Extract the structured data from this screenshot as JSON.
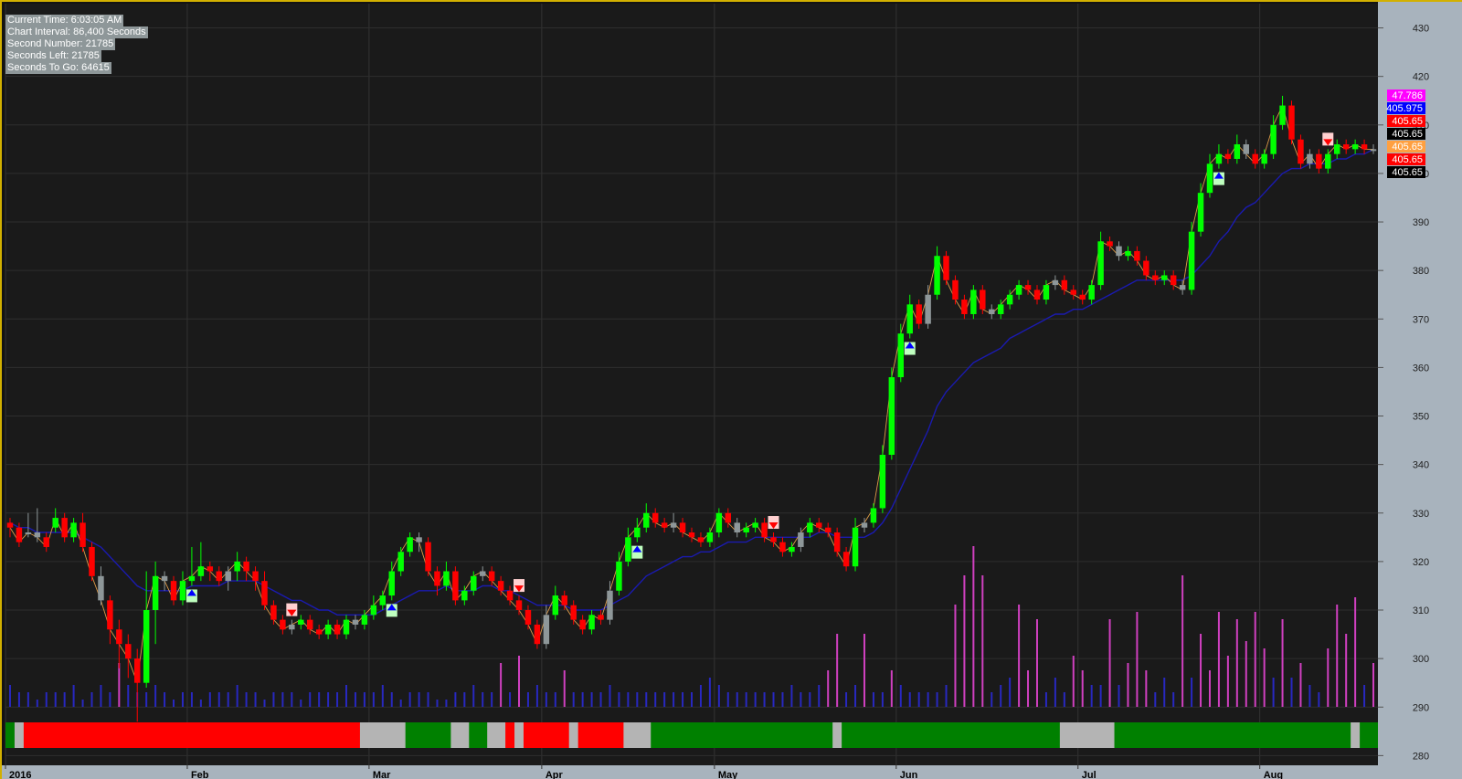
{
  "info": [
    "Current Time: 6:03:05 AM",
    "Chart Interval: 86,400 Seconds",
    "Second Number: 21785",
    "Seconds Left: 21785",
    "Seconds To Go: 64615"
  ],
  "colors": {
    "up": "#00ff00",
    "down": "#ff0000",
    "neutral": "#8e9799",
    "ma": "#1a1ab0",
    "zigzag": "#ffb050",
    "volume_up": "#d040c0",
    "volume_base": "#2828c0",
    "bar_green": "#008000",
    "bar_red": "#ff0000",
    "bar_gray": "#b4b4b4"
  },
  "price_labels": [
    {
      "text": "47.786",
      "bg": "#ff00ff",
      "fg": "#ffffff"
    },
    {
      "text": "405.975",
      "bg": "#0000ff",
      "fg": "#ffffff"
    },
    {
      "text": "405.65",
      "bg": "#ff0000",
      "fg": "#ffffff"
    },
    {
      "text": "405.65",
      "bg": "#000000",
      "fg": "#ffffff"
    },
    {
      "text": "405.65",
      "bg": "#ffa040",
      "fg": "#ffffff"
    },
    {
      "text": "405.65",
      "bg": "#ff0000",
      "fg": "#ffffff"
    },
    {
      "text": "405.65",
      "bg": "#000000",
      "fg": "#ffffff"
    }
  ],
  "chart_data": {
    "type": "candlestick",
    "y_ticks": [
      280,
      290,
      300,
      310,
      320,
      330,
      340,
      350,
      360,
      370,
      380,
      390,
      400,
      410,
      420,
      430
    ],
    "ylim": [
      278,
      435
    ],
    "x_labels": [
      "2016",
      "Feb",
      "Mar",
      "Apr",
      "May",
      "Jun",
      "Jul",
      "Aug"
    ],
    "x_label_index": [
      0,
      20,
      40,
      59,
      78,
      98,
      118,
      138
    ],
    "grid": true,
    "series_close": [
      327,
      324,
      326,
      325,
      323,
      329,
      325,
      328,
      323,
      317,
      312,
      306,
      303,
      300,
      295,
      310,
      317,
      316,
      312,
      316,
      317,
      319,
      318,
      316,
      318,
      320,
      318,
      316,
      311,
      308,
      306,
      307,
      308,
      306,
      305,
      307,
      305,
      308,
      307,
      309,
      311,
      313,
      318,
      322,
      325,
      324,
      318,
      315,
      318,
      312,
      314,
      317,
      318,
      316,
      314,
      312,
      310,
      307,
      303,
      309,
      313,
      311,
      308,
      306,
      309,
      308,
      314,
      320,
      325,
      327,
      330,
      328,
      327,
      328,
      326,
      325,
      324,
      326,
      330,
      328,
      326,
      327,
      328,
      325,
      324,
      322,
      323,
      326,
      328,
      327,
      326,
      322,
      319,
      327,
      328,
      331,
      342,
      358,
      367,
      373,
      369,
      375,
      383,
      378,
      374,
      371,
      376,
      372,
      371,
      373,
      375,
      377,
      376,
      374,
      377,
      378,
      376,
      375,
      374,
      377,
      386,
      385,
      383,
      384,
      382,
      379,
      378,
      379,
      377,
      376,
      388,
      396,
      402,
      404,
      403,
      406,
      404,
      402,
      404,
      410,
      414,
      407,
      402,
      404,
      401,
      404,
      406,
      405,
      406,
      405,
      405
    ],
    "candles": [
      [
        327,
        328,
        325,
        329
      ],
      [
        324,
        327,
        323,
        328
      ],
      [
        326,
        326,
        325,
        330
      ],
      [
        325,
        326,
        324,
        331
      ],
      [
        323,
        325,
        322,
        326
      ],
      [
        329,
        327,
        326,
        331
      ],
      [
        325,
        329,
        324,
        330
      ],
      [
        328,
        325,
        324,
        329
      ],
      [
        323,
        328,
        322,
        330
      ],
      [
        317,
        323,
        316,
        324
      ],
      [
        312,
        317,
        311,
        319
      ],
      [
        306,
        312,
        303,
        313
      ],
      [
        303,
        306,
        298,
        308
      ],
      [
        300,
        303,
        296,
        305
      ],
      [
        295,
        300,
        287,
        302
      ],
      [
        310,
        295,
        294,
        318
      ],
      [
        317,
        310,
        303,
        320
      ],
      [
        316,
        317,
        314,
        318
      ],
      [
        312,
        316,
        311,
        317
      ],
      [
        316,
        312,
        311,
        318
      ],
      [
        317,
        316,
        315,
        323
      ],
      [
        319,
        317,
        316,
        324
      ],
      [
        318,
        319,
        316,
        320
      ],
      [
        316,
        318,
        315,
        319
      ],
      [
        318,
        316,
        314,
        319
      ],
      [
        320,
        318,
        316,
        322
      ],
      [
        318,
        320,
        316,
        321
      ],
      [
        316,
        318,
        314,
        319
      ],
      [
        311,
        316,
        310,
        318
      ],
      [
        308,
        311,
        307,
        312
      ],
      [
        306,
        308,
        305,
        309
      ],
      [
        307,
        306,
        305,
        308
      ],
      [
        308,
        307,
        306,
        309
      ],
      [
        306,
        308,
        305,
        309
      ],
      [
        305,
        306,
        304,
        307
      ],
      [
        307,
        305,
        304,
        308
      ],
      [
        305,
        307,
        304,
        308
      ],
      [
        308,
        305,
        304,
        309
      ],
      [
        307,
        308,
        306,
        309
      ],
      [
        309,
        307,
        306,
        310
      ],
      [
        311,
        309,
        308,
        313
      ],
      [
        313,
        311,
        310,
        314
      ],
      [
        318,
        313,
        312,
        320
      ],
      [
        322,
        318,
        317,
        323
      ],
      [
        325,
        322,
        321,
        326
      ],
      [
        324,
        325,
        322,
        326
      ],
      [
        318,
        324,
        317,
        325
      ],
      [
        315,
        318,
        313,
        319
      ],
      [
        318,
        315,
        314,
        320
      ],
      [
        312,
        318,
        311,
        319
      ],
      [
        314,
        312,
        311,
        315
      ],
      [
        317,
        314,
        313,
        318
      ],
      [
        318,
        317,
        316,
        319
      ],
      [
        316,
        318,
        315,
        319
      ],
      [
        314,
        316,
        313,
        317
      ],
      [
        312,
        314,
        311,
        315
      ],
      [
        310,
        312,
        309,
        313
      ],
      [
        307,
        310,
        306,
        311
      ],
      [
        303,
        307,
        302,
        308
      ],
      [
        309,
        303,
        302,
        311
      ],
      [
        313,
        309,
        308,
        315
      ],
      [
        311,
        313,
        310,
        314
      ],
      [
        308,
        311,
        307,
        312
      ],
      [
        306,
        308,
        305,
        309
      ],
      [
        309,
        306,
        305,
        310
      ],
      [
        308,
        309,
        307,
        310
      ],
      [
        314,
        308,
        307,
        316
      ],
      [
        320,
        314,
        313,
        322
      ],
      [
        325,
        320,
        319,
        327
      ],
      [
        327,
        325,
        324,
        329
      ],
      [
        330,
        327,
        326,
        332
      ],
      [
        328,
        330,
        327,
        331
      ],
      [
        327,
        328,
        326,
        329
      ],
      [
        328,
        327,
        326,
        330
      ],
      [
        326,
        328,
        325,
        329
      ],
      [
        325,
        326,
        324,
        327
      ],
      [
        324,
        325,
        323,
        326
      ],
      [
        326,
        324,
        323,
        327
      ],
      [
        330,
        326,
        325,
        331
      ],
      [
        328,
        330,
        327,
        331
      ],
      [
        326,
        328,
        325,
        329
      ],
      [
        327,
        326,
        325,
        328
      ],
      [
        328,
        327,
        326,
        329
      ],
      [
        325,
        328,
        324,
        329
      ],
      [
        324,
        325,
        323,
        326
      ],
      [
        322,
        324,
        321,
        325
      ],
      [
        323,
        322,
        321,
        324
      ],
      [
        326,
        323,
        322,
        327
      ],
      [
        328,
        326,
        325,
        329
      ],
      [
        327,
        328,
        326,
        329
      ],
      [
        326,
        327,
        325,
        328
      ],
      [
        322,
        326,
        321,
        327
      ],
      [
        319,
        322,
        318,
        323
      ],
      [
        327,
        319,
        318,
        329
      ],
      [
        328,
        327,
        326,
        329
      ],
      [
        331,
        328,
        327,
        332
      ],
      [
        342,
        331,
        330,
        344
      ],
      [
        358,
        342,
        341,
        360
      ],
      [
        367,
        358,
        357,
        369
      ],
      [
        373,
        367,
        366,
        375
      ],
      [
        369,
        373,
        368,
        374
      ],
      [
        375,
        369,
        368,
        377
      ],
      [
        383,
        375,
        374,
        385
      ],
      [
        378,
        383,
        377,
        384
      ],
      [
        374,
        378,
        373,
        379
      ],
      [
        371,
        374,
        370,
        375
      ],
      [
        376,
        371,
        370,
        377
      ],
      [
        372,
        376,
        371,
        377
      ],
      [
        371,
        372,
        370,
        373
      ],
      [
        373,
        371,
        370,
        374
      ],
      [
        375,
        373,
        372,
        376
      ],
      [
        377,
        375,
        374,
        378
      ],
      [
        376,
        377,
        375,
        378
      ],
      [
        374,
        376,
        373,
        377
      ],
      [
        377,
        374,
        373,
        378
      ],
      [
        378,
        377,
        376,
        379
      ],
      [
        376,
        378,
        375,
        379
      ],
      [
        375,
        376,
        374,
        377
      ],
      [
        374,
        375,
        373,
        376
      ],
      [
        377,
        374,
        373,
        378
      ],
      [
        386,
        377,
        376,
        388
      ],
      [
        385,
        386,
        384,
        387
      ],
      [
        383,
        385,
        382,
        386
      ],
      [
        384,
        383,
        382,
        385
      ],
      [
        382,
        384,
        381,
        385
      ],
      [
        379,
        382,
        378,
        383
      ],
      [
        378,
        379,
        377,
        380
      ],
      [
        379,
        378,
        377,
        380
      ],
      [
        377,
        379,
        376,
        380
      ],
      [
        376,
        377,
        375,
        378
      ],
      [
        388,
        376,
        375,
        390
      ],
      [
        396,
        388,
        387,
        398
      ],
      [
        402,
        396,
        395,
        404
      ],
      [
        404,
        402,
        401,
        406
      ],
      [
        403,
        404,
        402,
        405
      ],
      [
        406,
        403,
        402,
        408
      ],
      [
        404,
        406,
        403,
        407
      ],
      [
        402,
        404,
        401,
        405
      ],
      [
        404,
        402,
        401,
        405
      ],
      [
        410,
        404,
        403,
        412
      ],
      [
        414,
        410,
        409,
        416
      ],
      [
        407,
        414,
        406,
        415
      ],
      [
        402,
        407,
        401,
        408
      ],
      [
        404,
        402,
        401,
        405
      ],
      [
        401,
        404,
        400,
        405
      ],
      [
        404,
        401,
        400,
        405
      ],
      [
        406,
        404,
        403,
        407
      ],
      [
        405,
        406,
        404,
        407
      ],
      [
        406,
        405,
        404,
        407
      ],
      [
        405,
        406,
        404,
        407
      ],
      [
        405,
        405,
        404,
        406
      ]
    ],
    "volume": [
      3,
      2,
      2,
      1,
      2,
      2,
      2,
      3,
      1,
      2,
      3,
      2,
      6,
      3,
      2,
      2,
      3,
      2,
      1,
      2,
      2,
      1,
      2,
      2,
      2,
      3,
      2,
      2,
      1,
      2,
      2,
      2,
      1,
      2,
      2,
      2,
      2,
      3,
      2,
      2,
      2,
      3,
      2,
      1,
      2,
      2,
      2,
      1,
      1,
      2,
      2,
      3,
      2,
      2,
      6,
      2,
      7,
      2,
      3,
      2,
      2,
      5,
      2,
      2,
      2,
      2,
      3,
      2,
      2,
      2,
      2,
      2,
      2,
      2,
      2,
      2,
      3,
      4,
      3,
      2,
      2,
      2,
      2,
      2,
      2,
      2,
      3,
      2,
      2,
      3,
      5,
      10,
      2,
      3,
      10,
      2,
      2,
      5,
      3,
      2,
      2,
      2,
      2,
      3,
      14,
      18,
      22,
      18,
      2,
      3,
      4,
      14,
      5,
      12,
      2,
      4,
      2,
      7,
      5,
      3,
      3,
      12,
      3,
      6,
      13,
      5,
      2,
      4,
      2,
      18,
      4,
      10,
      5,
      13,
      7,
      12,
      9,
      13,
      8,
      4,
      12,
      4,
      6,
      3,
      2,
      8,
      14,
      10,
      15,
      3,
      6
    ],
    "ma": [
      328,
      327,
      327,
      326,
      326,
      326,
      326,
      326,
      325,
      324,
      323,
      321,
      319,
      317,
      315,
      314,
      314,
      314,
      314,
      314,
      315,
      315,
      315,
      315,
      316,
      316,
      316,
      316,
      315,
      314,
      313,
      312,
      312,
      311,
      310,
      310,
      309,
      309,
      309,
      309,
      309,
      310,
      311,
      312,
      313,
      314,
      314,
      314,
      315,
      314,
      314,
      314,
      315,
      315,
      314,
      314,
      313,
      312,
      311,
      311,
      311,
      311,
      310,
      310,
      310,
      310,
      311,
      312,
      313,
      315,
      317,
      318,
      319,
      320,
      321,
      321,
      322,
      322,
      323,
      324,
      324,
      324,
      325,
      325,
      325,
      325,
      325,
      325,
      325,
      326,
      326,
      325,
      325,
      325,
      325,
      326,
      328,
      331,
      335,
      339,
      343,
      347,
      352,
      355,
      357,
      359,
      361,
      362,
      363,
      364,
      366,
      367,
      368,
      369,
      370,
      371,
      371,
      372,
      372,
      373,
      374,
      375,
      376,
      377,
      378,
      378,
      378,
      378,
      378,
      378,
      379,
      381,
      383,
      386,
      388,
      391,
      393,
      394,
      396,
      398,
      400,
      401,
      401,
      402,
      402,
      402,
      403,
      403,
      404,
      404,
      405
    ],
    "bottom_bar": [
      "g",
      "gr",
      "r",
      "r",
      "r",
      "r",
      "r",
      "r",
      "r",
      "r",
      "r",
      "r",
      "r",
      "r",
      "r",
      "r",
      "r",
      "r",
      "r",
      "r",
      "r",
      "r",
      "r",
      "r",
      "r",
      "r",
      "r",
      "r",
      "r",
      "r",
      "r",
      "r",
      "r",
      "r",
      "r",
      "r",
      "r",
      "r",
      "r",
      "gr",
      "gr",
      "gr",
      "gr",
      "gr",
      "g",
      "g",
      "g",
      "g",
      "g",
      "gr",
      "gr",
      "g",
      "g",
      "gr",
      "gr",
      "r",
      "gr",
      "r",
      "r",
      "r",
      "r",
      "r",
      "gr",
      "r",
      "r",
      "r",
      "r",
      "r",
      "gr",
      "gr",
      "gr",
      "g",
      "g",
      "g",
      "g",
      "g",
      "g",
      "g",
      "g",
      "g",
      "g",
      "g",
      "g",
      "g",
      "g",
      "g",
      "g",
      "g",
      "g",
      "g",
      "g",
      "gr",
      "g",
      "g",
      "g",
      "g",
      "g",
      "g",
      "g",
      "g",
      "g",
      "g",
      "g",
      "g",
      "g",
      "g",
      "g",
      "g",
      "g",
      "g",
      "g",
      "g",
      "g",
      "g",
      "g",
      "g",
      "gr",
      "gr",
      "gr",
      "gr",
      "gr",
      "gr",
      "g",
      "g",
      "g",
      "g",
      "g",
      "g",
      "g",
      "g",
      "g",
      "g",
      "g",
      "g",
      "g",
      "g",
      "g",
      "g",
      "g",
      "g",
      "g",
      "g",
      "g",
      "g",
      "g",
      "g",
      "g",
      "g",
      "gr",
      "g",
      "g",
      "g",
      "g",
      "g"
    ],
    "signals_up": [
      20,
      42,
      69,
      99,
      133
    ],
    "signals_down": [
      31,
      56,
      84,
      145
    ]
  }
}
